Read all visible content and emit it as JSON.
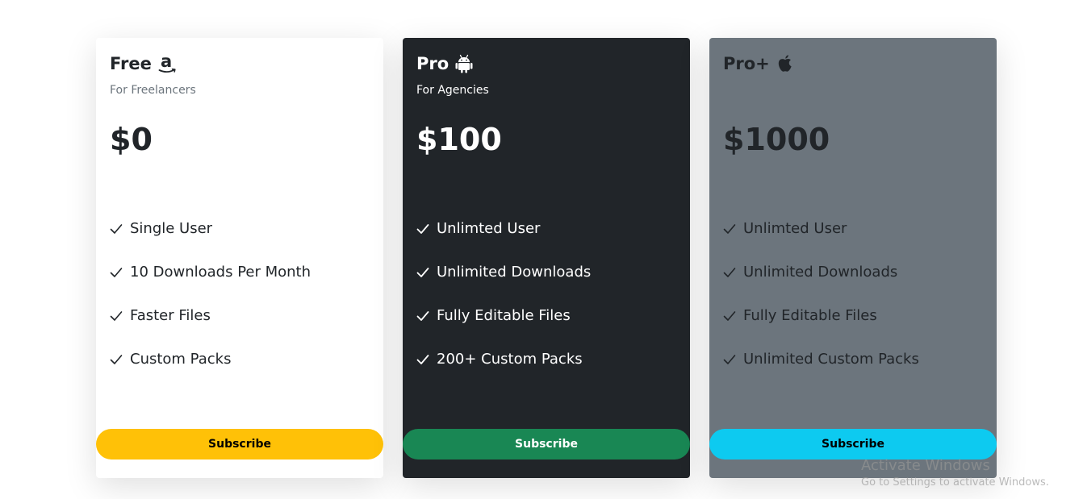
{
  "plans": [
    {
      "title": "Free",
      "icon": "amazon-icon",
      "subtitle": "For Freelancers",
      "price": "$0",
      "features": [
        "Single User",
        "10 Downloads Per Month",
        "Faster Files",
        "Custom Packs"
      ],
      "button_label": "Subscribe",
      "card_color": "#ffffff",
      "button_color": "#ffc107"
    },
    {
      "title": "Pro",
      "icon": "android-icon",
      "subtitle": "For Agencies",
      "price": "$100",
      "features": [
        "Unlimted User",
        "Unlimited Downloads",
        "Fully Editable Files",
        "200+ Custom Packs"
      ],
      "button_label": "Subscribe",
      "card_color": "#212529",
      "button_color": "#198754"
    },
    {
      "title": "Pro+",
      "icon": "apple-icon",
      "subtitle": "",
      "price": "$1000",
      "features": [
        "Unlimted User",
        "Unlimited Downloads",
        "Fully Editable Files",
        "Unlimited Custom Packs"
      ],
      "button_label": "Subscribe",
      "card_color": "#6c757d",
      "button_color": "#0dcaf0"
    }
  ],
  "watermark": {
    "title": "Activate Windows",
    "subtitle": "Go to Settings to activate Windows."
  }
}
